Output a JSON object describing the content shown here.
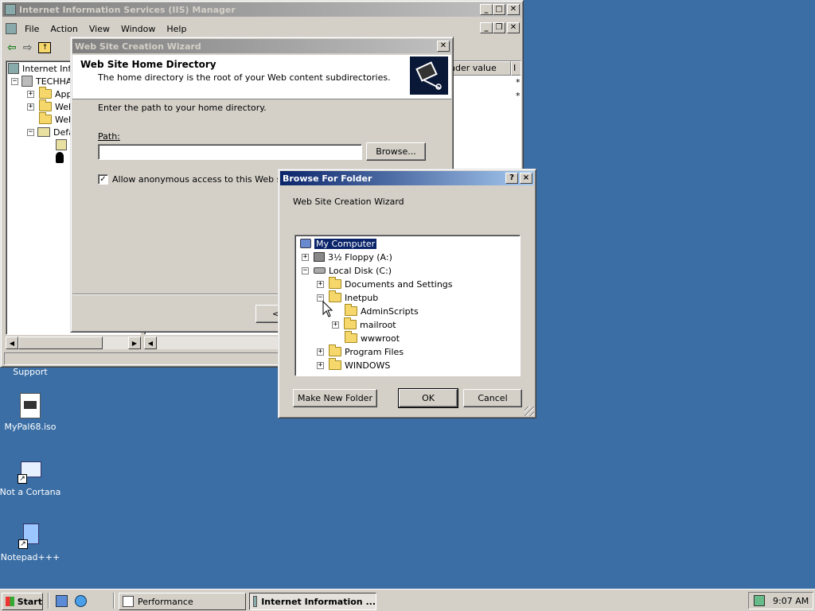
{
  "iis": {
    "title": "Internet Information Services (IIS) Manager",
    "menu": [
      "File",
      "Action",
      "View",
      "Window",
      "Help"
    ],
    "tree": {
      "root": "Internet Infor",
      "server": "TECHHA",
      "app": "Appl",
      "web1": "Web",
      "web2": "Web",
      "default": "Defa"
    },
    "column_header": "nder value",
    "col_i": "I",
    "star1": "*",
    "star2": "*"
  },
  "wizard": {
    "title": "Web Site Creation Wizard",
    "heading": "Web Site Home Directory",
    "subheading": "The home directory is the root of your Web content subdirectories.",
    "prompt": "Enter the path to your home directory.",
    "path_label": "Path:",
    "path_value": "",
    "browse_label": "Browse...",
    "anon_label": "Allow anonymous access to this Web site",
    "back_fragment": "<"
  },
  "browse": {
    "title": "Browse For Folder",
    "help_label": "?",
    "close_label": "×",
    "description": "Web Site Creation Wizard",
    "tree": [
      {
        "label": "My Computer",
        "selected": true
      },
      {
        "label": "3½ Floppy (A:)"
      },
      {
        "label": "Local Disk (C:)"
      },
      {
        "label": "Documents and Settings"
      },
      {
        "label": "Inetpub"
      },
      {
        "label": "AdminScripts"
      },
      {
        "label": "mailroot"
      },
      {
        "label": "wwwroot"
      },
      {
        "label": "Program Files"
      },
      {
        "label": "WINDOWS"
      }
    ],
    "make_folder_label": "Make New Folder",
    "ok_label": "OK",
    "cancel_label": "Cancel"
  },
  "desktop": {
    "icons": [
      {
        "label": "Support"
      },
      {
        "label": "MyPal68.iso"
      },
      {
        "label": "Not a Cortana"
      },
      {
        "label": "Notepad+++"
      }
    ]
  },
  "taskbar": {
    "start_label": "Start",
    "tasks": [
      {
        "label": "Performance"
      },
      {
        "label": "Internet Information ..."
      }
    ],
    "clock": "9:07 AM"
  },
  "colors": {
    "desktop": "#3a6ea5",
    "titlebar_active": "#0a246a",
    "face": "#d4d0c8",
    "selection": "#0a246a"
  }
}
